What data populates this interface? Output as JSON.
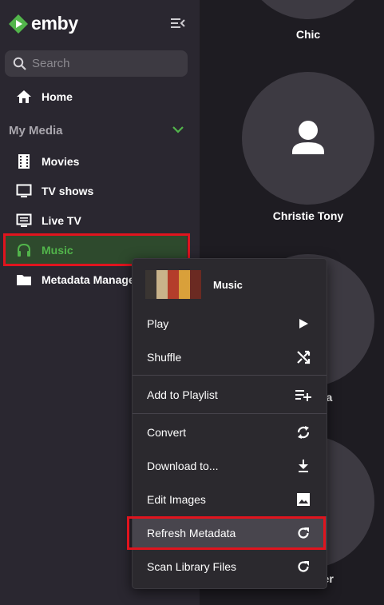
{
  "app": {
    "name": "emby",
    "brand_color": "#52b54b",
    "highlight_color": "#e0141e"
  },
  "sidebar": {
    "search_placeholder": "Search",
    "home_label": "Home",
    "section_title": "My Media",
    "items": [
      {
        "label": "Movies",
        "icon": "film-icon"
      },
      {
        "label": "TV shows",
        "icon": "tv-icon"
      },
      {
        "label": "Live TV",
        "icon": "live-tv-icon"
      },
      {
        "label": "Music",
        "icon": "headphones-icon",
        "active": true
      },
      {
        "label": "Metadata Manager",
        "icon": "folder-icon"
      }
    ]
  },
  "main": {
    "people": [
      {
        "name": "Chic"
      },
      {
        "name": "Christie Tony"
      },
      {
        "name": "ula"
      },
      {
        "name": "her"
      }
    ]
  },
  "context_menu": {
    "title": "Music",
    "items": [
      {
        "label": "Play",
        "icon": "play-icon"
      },
      {
        "label": "Shuffle",
        "icon": "shuffle-icon"
      },
      {
        "label": "Add to Playlist",
        "icon": "playlist-add-icon"
      },
      {
        "label": "Convert",
        "icon": "sync-icon"
      },
      {
        "label": "Download to...",
        "icon": "download-icon"
      },
      {
        "label": "Edit Images",
        "icon": "image-icon"
      },
      {
        "label": "Refresh Metadata",
        "icon": "refresh-icon",
        "highlighted": true
      },
      {
        "label": "Scan Library Files",
        "icon": "refresh-icon"
      }
    ]
  }
}
